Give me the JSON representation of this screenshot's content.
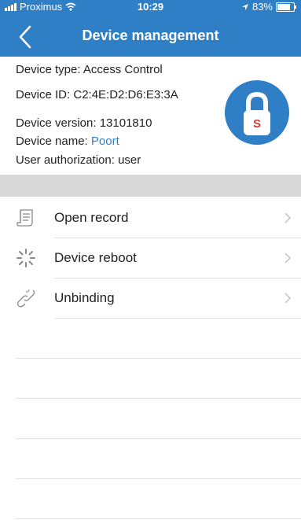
{
  "status_bar": {
    "carrier": "Proximus",
    "time": "10:29",
    "battery": "83%"
  },
  "nav": {
    "title": "Device management"
  },
  "device": {
    "type_label": "Device type:",
    "type_value": "Access Control",
    "id_label": "Device ID:",
    "id_value": "C2:4E:D2:D6:E3:3A",
    "version_label": "Device version:",
    "version_value": "13101810",
    "name_label": "Device name:",
    "name_value": "Poort",
    "auth_label": "User authorization:",
    "auth_value": "user",
    "badge_letter": "S"
  },
  "menu": {
    "items": [
      {
        "label": "Open record",
        "icon": "document-icon"
      },
      {
        "label": "Device reboot",
        "icon": "spinner-icon"
      },
      {
        "label": "Unbinding",
        "icon": "unlink-icon"
      }
    ]
  },
  "colors": {
    "accent": "#2f7fc7",
    "band": "#d9d9d9",
    "separator": "#e3e3e3"
  }
}
